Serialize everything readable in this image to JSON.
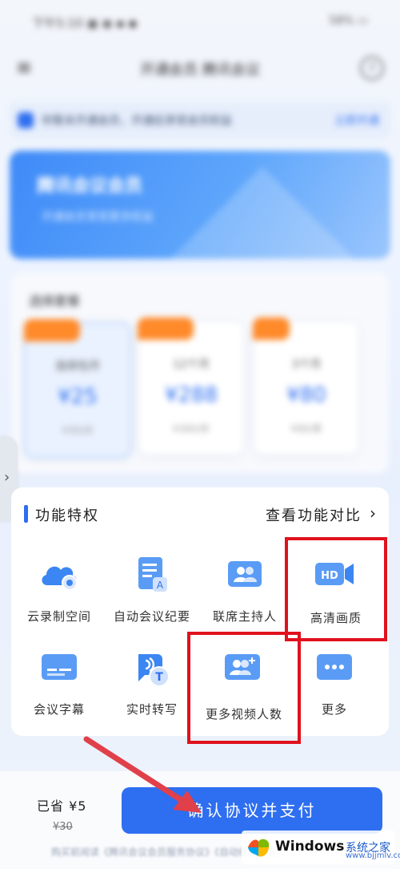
{
  "status_bar": {
    "time": "下午5:10 ▣ ◉ ▪ ◆",
    "battery": "58% ▭"
  },
  "nav": {
    "back": "≡",
    "title": "开通会员 腾讯会议",
    "help": "?"
  },
  "notice": {
    "text": "你暂未开通会员，开通后享受会员权益",
    "link": "立即开通"
  },
  "banner": {
    "title": "腾讯会议会员",
    "subtitle": "开通会员享受更多权益"
  },
  "plans": {
    "title": "选择套餐",
    "items": [
      {
        "name": "连续包月",
        "price": "¥25",
        "original": "¥30/月"
      },
      {
        "name": "12个月",
        "price": "¥288",
        "original": "¥360/年"
      },
      {
        "name": "3个月",
        "price": "¥80",
        "original": "¥90/季"
      }
    ]
  },
  "side_handle": "›",
  "features": {
    "title": "功能特权",
    "compare": "查看功能对比",
    "chevron": "›",
    "items": [
      {
        "label": "云录制空间",
        "icon": "cloud-record-icon"
      },
      {
        "label": "自动会议纪要",
        "icon": "meeting-minutes-icon"
      },
      {
        "label": "联席主持人",
        "icon": "co-host-icon"
      },
      {
        "label": "高清画质",
        "icon": "hd-video-icon"
      },
      {
        "label": "会议字幕",
        "icon": "subtitle-icon"
      },
      {
        "label": "实时转写",
        "icon": "transcription-icon"
      },
      {
        "label": "更多视频人数",
        "icon": "more-participants-icon"
      },
      {
        "label": "更多",
        "icon": "more-icon"
      }
    ]
  },
  "bottom": {
    "saved": "已省 ¥5",
    "original": "¥30",
    "pay_button": "确认协议并支付",
    "agreement": "购买前阅读《腾讯会议会员服务协议》《自动续费协议》"
  },
  "watermark": {
    "brand": "Windows",
    "site": "系统之家",
    "url": "www.bjjmlv.com"
  },
  "colors": {
    "accent": "#2e6ef0",
    "highlight": "#e0121d",
    "arrow": "#e0404a",
    "badge": "#ff8a2a"
  }
}
